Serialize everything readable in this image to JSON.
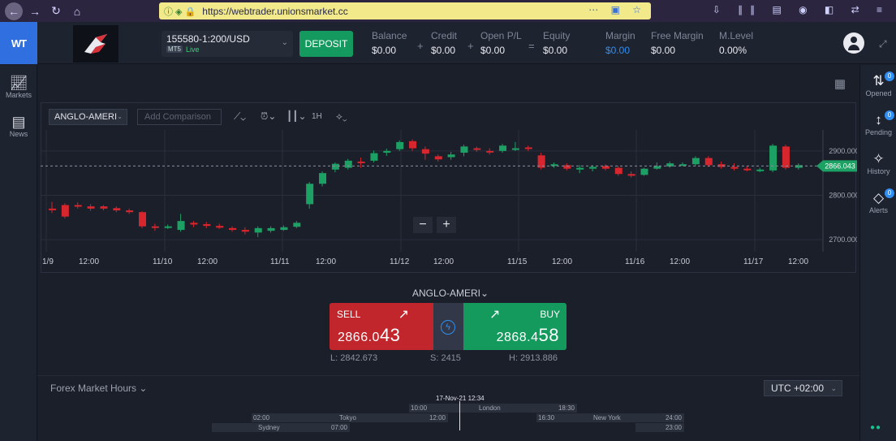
{
  "browser": {
    "url": "https://webtrader.unionsmarket.cc",
    "back_glyph": "←",
    "forward_glyph": "→",
    "reload_glyph": "↻",
    "home_glyph": "⌂",
    "right_icons": "⋯ ▣ ☆",
    "toolbar_icons": "⇩ ∥∥ ▤ ◉ ◧ ⇄ ≡"
  },
  "header": {
    "logo": "WT",
    "account_number": "155580-1:200/USD",
    "account_type": "MT5",
    "account_mode": "Live",
    "deposit_label": "DEPOSIT",
    "stats": [
      {
        "label": "Balance",
        "value": "$0.00"
      },
      {
        "label": "Credit",
        "value": "$0.00"
      },
      {
        "label": "Open P/L",
        "value": "$0.00"
      },
      {
        "label": "Equity",
        "value": "$0.00"
      },
      {
        "label": "Margin",
        "value": "$0.00"
      },
      {
        "label": "Free Margin",
        "value": "$0.00"
      },
      {
        "label": "M.Level",
        "value": "0.00%"
      }
    ],
    "operators": [
      "+",
      "+",
      "="
    ]
  },
  "left_nav": [
    {
      "label": "Markets",
      "icon": "chart-icon"
    },
    {
      "label": "News",
      "icon": "news-icon"
    }
  ],
  "right_nav": [
    {
      "label": "Opened",
      "badge": "0",
      "icon": "swap-icon"
    },
    {
      "label": "Pending",
      "badge": "0",
      "icon": "pending-icon"
    },
    {
      "label": "History",
      "badge": "",
      "icon": "history-icon"
    },
    {
      "label": "Alerts",
      "badge": "0",
      "icon": "tag-icon"
    }
  ],
  "chart_toolbar": {
    "symbol": "ANGLO-AMERI",
    "comparison_placeholder": "Add Comparison",
    "timeframe": "1H"
  },
  "chart_data": {
    "type": "candlestick",
    "y_ticks": [
      "2900.000",
      "2800.000",
      "2700.000"
    ],
    "x_labels": [
      "1/9",
      "12:00",
      "11/10",
      "12:00",
      "11/11",
      "12:00",
      "11/12",
      "12:00",
      "11/15",
      "12:00",
      "11/16",
      "12:00",
      "11/17",
      "12:00"
    ],
    "last_price": "2866.043",
    "ylim": [
      2680,
      2940
    ]
  },
  "trade": {
    "symbol": "ANGLO-AMERI",
    "sell_label": "SELL",
    "buy_label": "BUY",
    "sell_price_small": "2866.0",
    "sell_price_big": "43",
    "buy_price_small": "2868.4",
    "buy_price_big": "58",
    "low": "L: 2842.673",
    "spread": "S: 2415",
    "high": "H: 2913.886"
  },
  "market_hours": {
    "title": "Forex Market Hours",
    "timezone": "UTC +02:00",
    "now": "17-Nov-21 12:34",
    "sessions": [
      {
        "name": "London",
        "start": "10:00",
        "end": "18:30"
      },
      {
        "name": "Tokyo",
        "start": "02:00",
        "end": "12:00"
      },
      {
        "name": "New York",
        "start": "16:30",
        "end": "24:00"
      },
      {
        "name": "Sydney",
        "start": "",
        "end": "07:00"
      },
      {
        "name": "",
        "start": "",
        "end": "23:00"
      }
    ]
  }
}
